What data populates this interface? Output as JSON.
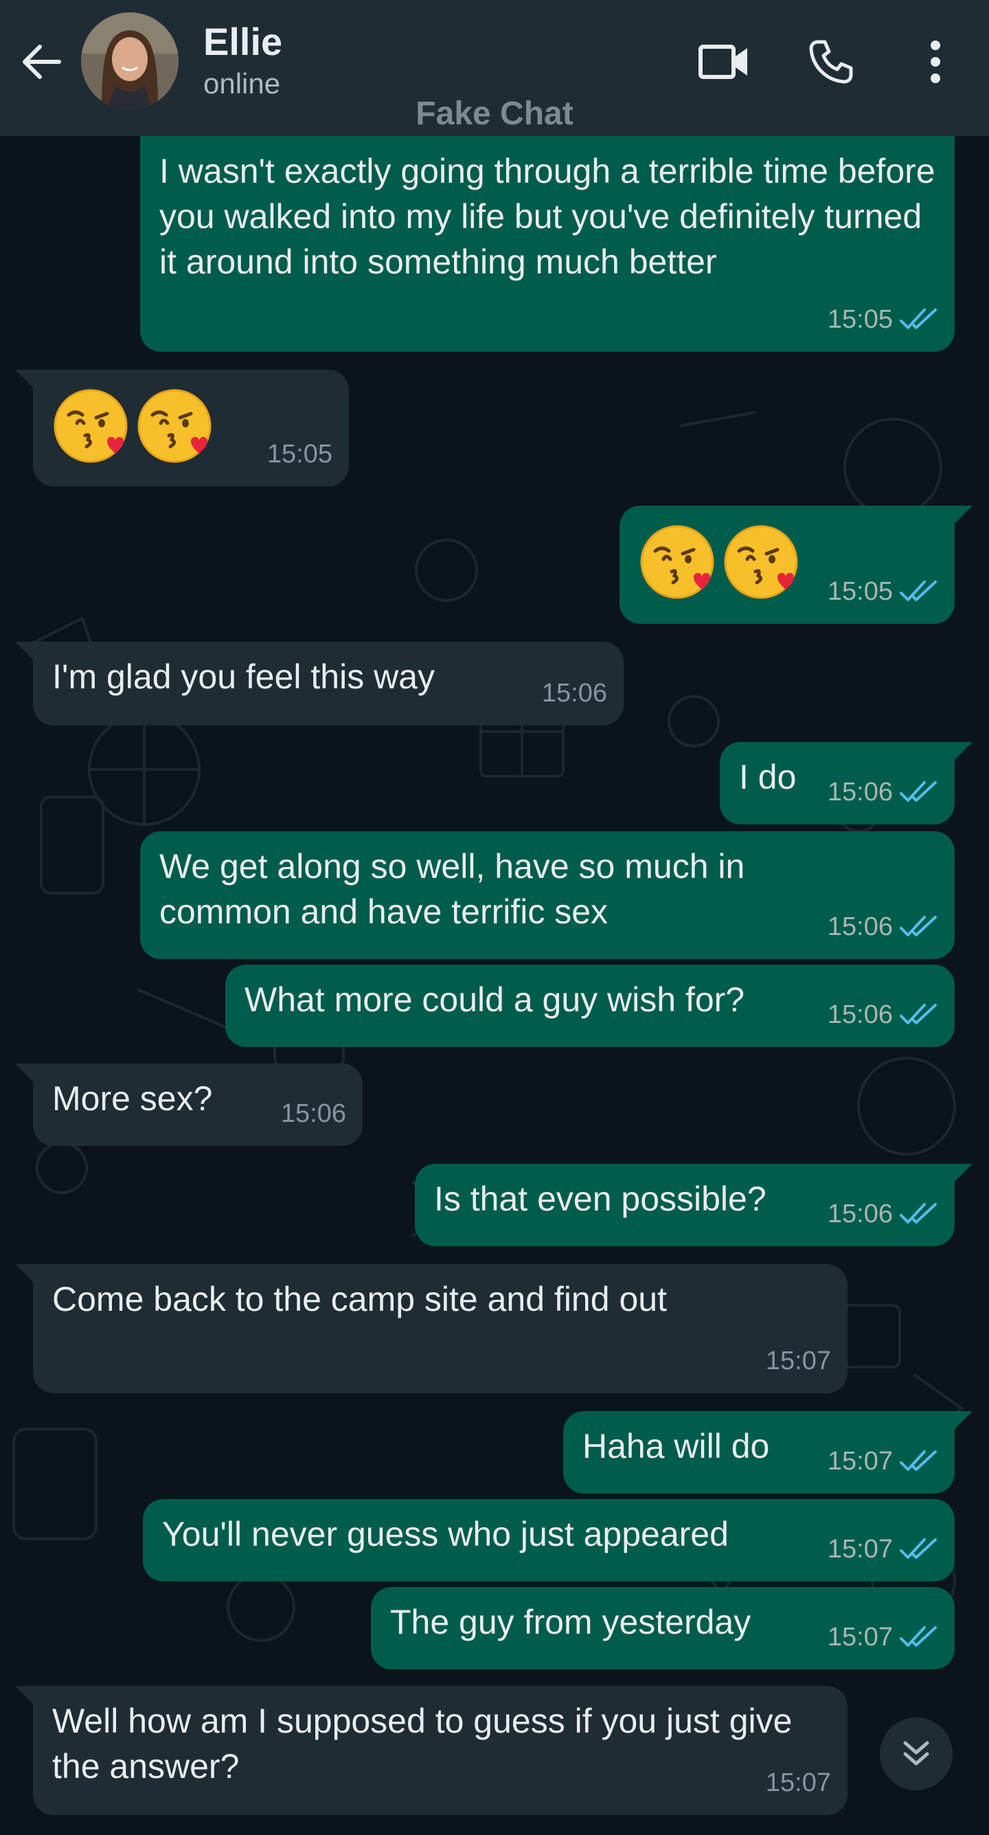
{
  "header": {
    "contact_name": "Ellie",
    "status": "online",
    "watermark": "Fake Chat",
    "icons": [
      "back-arrow-icon",
      "video-call-icon",
      "voice-call-icon",
      "more-options-icon"
    ]
  },
  "colors": {
    "header_bg": "#1f2c34",
    "chat_bg": "#0b141a",
    "outgoing_bubble": "#005c4b",
    "incoming_bubble": "#1f2c34",
    "read_tick": "#53bdeb",
    "text": "#e9edef",
    "timestamp": "#8696a0"
  },
  "messages": [
    {
      "direction": "out",
      "text": "I wasn't exactly going through a terrible time before you walked into my life but you've definitely turned it around into something much better",
      "time": "15:05",
      "status": "read"
    },
    {
      "direction": "in",
      "text": "",
      "emoji": [
        "kissing-face-with-heart-emoji",
        "kissing-face-with-heart-emoji"
      ],
      "time": "15:05"
    },
    {
      "direction": "out",
      "text": "",
      "emoji": [
        "kissing-face-with-heart-emoji",
        "kissing-face-with-heart-emoji"
      ],
      "time": "15:05",
      "status": "read"
    },
    {
      "direction": "in",
      "text": "I'm glad you feel this way",
      "time": "15:06"
    },
    {
      "direction": "out",
      "text": "I do",
      "time": "15:06",
      "status": "read"
    },
    {
      "direction": "out",
      "text": "We get along so well, have so much in common and have terrific sex",
      "time": "15:06",
      "status": "read"
    },
    {
      "direction": "out",
      "text": "What more could a guy wish for?",
      "time": "15:06",
      "status": "read"
    },
    {
      "direction": "in",
      "text": "More sex?",
      "time": "15:06"
    },
    {
      "direction": "out",
      "text": "Is that even possible?",
      "time": "15:06",
      "status": "read"
    },
    {
      "direction": "in",
      "text": "Come back to the camp site and find out",
      "time": "15:07"
    },
    {
      "direction": "out",
      "text": "Haha will do",
      "time": "15:07",
      "status": "read"
    },
    {
      "direction": "out",
      "text": "You'll never guess who just appeared",
      "time": "15:07",
      "status": "read"
    },
    {
      "direction": "out",
      "text": "The guy from yesterday",
      "time": "15:07",
      "status": "read"
    },
    {
      "direction": "in",
      "text": "Well how am I supposed to guess if you just give the answer?",
      "time": "15:07"
    }
  ],
  "scroll_button": {
    "icon": "double-chevron-down-icon"
  }
}
